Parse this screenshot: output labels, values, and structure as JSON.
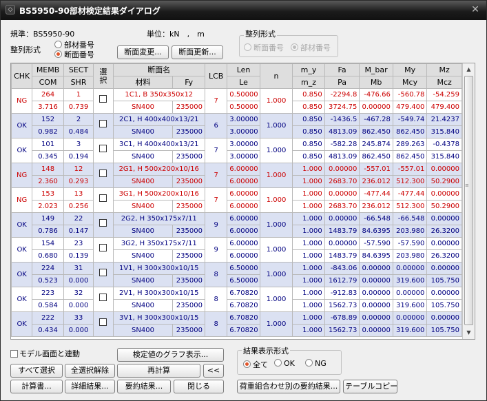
{
  "window": {
    "title": "BS5950-90部材検定結果ダイアログ",
    "close_glyph": "✕"
  },
  "info": {
    "code_label": "規準：BS5950-90",
    "unit_label": "単位：kN　,　m"
  },
  "sort_left": {
    "label": "整列形式",
    "option1": "部材番号",
    "option2": "断面番号",
    "selected": "断面番号"
  },
  "buttons_top": {
    "section_change": "断面変更...",
    "section_update": "断面更新..."
  },
  "sort_right": {
    "label": "整列形式",
    "option1": "断面番号",
    "option2": "部材番号",
    "selected": "部材番号",
    "disabled": true
  },
  "headers": {
    "chk": "CHK",
    "memb": "MEMB",
    "sect": "SECT",
    "com": "COM",
    "shr": "SHR",
    "select": "選\n択",
    "section_name": "断面名",
    "material": "材料",
    "fy": "Fy",
    "lcb": "LCB",
    "len": "Len",
    "le": "Le",
    "n": "n",
    "m_y": "m_y",
    "m_z": "m_z",
    "fa": "Fa",
    "pa": "Pa",
    "m_bar": "M_bar",
    "mb": "Mb",
    "my": "My",
    "mcy": "Mcy",
    "mz": "Mz",
    "mcz": "Mcz"
  },
  "rows": [
    {
      "chk": "NG",
      "memb": "264",
      "sect": "1",
      "com": "3.716",
      "shr": "0.739",
      "section": "1C1, B 350x350x12",
      "material": "SN400",
      "fy": "235000",
      "lcb": "7",
      "len": "0.50000",
      "le": "0.50000",
      "n": "1.000",
      "m_y": "0.850",
      "m_z": "0.850",
      "fa": "-2294.8",
      "pa": "3724.75",
      "m_bar": "-476.66",
      "mb": "0.00000",
      "my": "-560.78",
      "mcy": "479.400",
      "mz": "-54.259",
      "mcz": "479.400"
    },
    {
      "chk": "OK",
      "memb": "152",
      "sect": "2",
      "com": "0.982",
      "shr": "0.484",
      "section": "2C1, H 400x400x13/21",
      "material": "SN400",
      "fy": "235000",
      "lcb": "6",
      "len": "3.00000",
      "le": "3.00000",
      "n": "1.000",
      "m_y": "0.850",
      "m_z": "0.850",
      "fa": "-1436.5",
      "pa": "4813.09",
      "m_bar": "-467.28",
      "mb": "862.450",
      "my": "-549.74",
      "mcy": "862.450",
      "mz": "21.4237",
      "mcz": "315.840"
    },
    {
      "chk": "OK",
      "memb": "101",
      "sect": "3",
      "com": "0.345",
      "shr": "0.194",
      "section": "3C1, H 400x400x13/21",
      "material": "SN400",
      "fy": "235000",
      "lcb": "7",
      "len": "3.00000",
      "le": "3.00000",
      "n": "1.000",
      "m_y": "0.850",
      "m_z": "0.850",
      "fa": "-582.28",
      "pa": "4813.09",
      "m_bar": "245.874",
      "mb": "862.450",
      "my": "289.263",
      "mcy": "862.450",
      "mz": "-0.4378",
      "mcz": "315.840"
    },
    {
      "chk": "NG",
      "memb": "148",
      "sect": "12",
      "com": "2.360",
      "shr": "0.293",
      "section": "2G1, H 500x200x10/16",
      "material": "SN400",
      "fy": "235000",
      "lcb": "7",
      "len": "6.00000",
      "le": "6.00000",
      "n": "1.000",
      "m_y": "1.000",
      "m_z": "1.000",
      "fa": "0.00000",
      "pa": "2683.70",
      "m_bar": "-557.01",
      "mb": "236.012",
      "my": "-557.01",
      "mcy": "512.300",
      "mz": "0.00000",
      "mcz": "50.2900"
    },
    {
      "chk": "NG",
      "memb": "153",
      "sect": "13",
      "com": "2.023",
      "shr": "0.256",
      "section": "3G1, H 500x200x10/16",
      "material": "SN400",
      "fy": "235000",
      "lcb": "7",
      "len": "6.00000",
      "le": "6.00000",
      "n": "1.000",
      "m_y": "1.000",
      "m_z": "1.000",
      "fa": "0.00000",
      "pa": "2683.70",
      "m_bar": "-477.44",
      "mb": "236.012",
      "my": "-477.44",
      "mcy": "512.300",
      "mz": "0.00000",
      "mcz": "50.2900"
    },
    {
      "chk": "OK",
      "memb": "149",
      "sect": "22",
      "com": "0.786",
      "shr": "0.147",
      "section": "2G2, H 350x175x7/11",
      "material": "SN400",
      "fy": "235000",
      "lcb": "9",
      "len": "6.00000",
      "le": "6.00000",
      "n": "1.000",
      "m_y": "1.000",
      "m_z": "1.000",
      "fa": "0.00000",
      "pa": "1483.79",
      "m_bar": "-66.548",
      "mb": "84.6395",
      "my": "-66.548",
      "mcy": "203.980",
      "mz": "0.00000",
      "mcz": "26.3200"
    },
    {
      "chk": "OK",
      "memb": "154",
      "sect": "23",
      "com": "0.680",
      "shr": "0.139",
      "section": "3G2, H 350x175x7/11",
      "material": "SN400",
      "fy": "235000",
      "lcb": "9",
      "len": "6.00000",
      "le": "6.00000",
      "n": "1.000",
      "m_y": "1.000",
      "m_z": "1.000",
      "fa": "0.00000",
      "pa": "1483.79",
      "m_bar": "-57.590",
      "mb": "84.6395",
      "my": "-57.590",
      "mcy": "203.980",
      "mz": "0.00000",
      "mcz": "26.3200"
    },
    {
      "chk": "OK",
      "memb": "224",
      "sect": "31",
      "com": "0.523",
      "shr": "0.000",
      "section": "1V1, H 300x300x10/15",
      "material": "SN400",
      "fy": "235000",
      "lcb": "8",
      "len": "6.50000",
      "le": "6.50000",
      "n": "1.000",
      "m_y": "1.000",
      "m_z": "1.000",
      "fa": "-843.06",
      "pa": "1612.79",
      "m_bar": "0.00000",
      "mb": "0.00000",
      "my": "0.00000",
      "mcy": "319.600",
      "mz": "0.00000",
      "mcz": "105.750"
    },
    {
      "chk": "OK",
      "memb": "223",
      "sect": "32",
      "com": "0.584",
      "shr": "0.000",
      "section": "2V1, H 300x300x10/15",
      "material": "SN400",
      "fy": "235000",
      "lcb": "8",
      "len": "6.70820",
      "le": "6.70820",
      "n": "1.000",
      "m_y": "1.000",
      "m_z": "1.000",
      "fa": "-912.83",
      "pa": "1562.73",
      "m_bar": "0.00000",
      "mb": "0.00000",
      "my": "0.00000",
      "mcy": "319.600",
      "mz": "0.00000",
      "mcz": "105.750"
    },
    {
      "chk": "OK",
      "memb": "222",
      "sect": "33",
      "com": "0.434",
      "shr": "0.000",
      "section": "3V1, H 300x300x10/15",
      "material": "SN400",
      "fy": "235000",
      "lcb": "8",
      "len": "6.70820",
      "le": "6.70820",
      "n": "1.000",
      "m_y": "1.000",
      "m_z": "1.000",
      "fa": "-678.89",
      "pa": "1562.73",
      "m_bar": "0.00000",
      "mb": "0.00000",
      "my": "0.00000",
      "mcy": "319.600",
      "mz": "0.00000",
      "mcz": "105.750"
    }
  ],
  "bottom": {
    "link_model": "モデル画面と連動",
    "graph_button": "検定値のグラフ表示...",
    "select_all": "すべて選択",
    "deselect_all": "全選択解除",
    "recalc": "再計算",
    "collapse": "<<",
    "calc_sheet": "計算書...",
    "detail": "詳細結果...",
    "summary": "要約結果...",
    "close": "閉じる",
    "combo_summary": "荷重組合わせ別の要約結果...",
    "copy_table": "テーブルコピー"
  },
  "result_filter": {
    "label": "結果表示形式",
    "all": "全て",
    "ok": "OK",
    "ng": "NG",
    "selected": "全て"
  },
  "colors": {
    "ng_text": "#cc0000",
    "ok_text": "#000080",
    "shade": "#dbe1f2",
    "titlebar": "#1c1c1c",
    "radio_on": "#e2552a"
  }
}
